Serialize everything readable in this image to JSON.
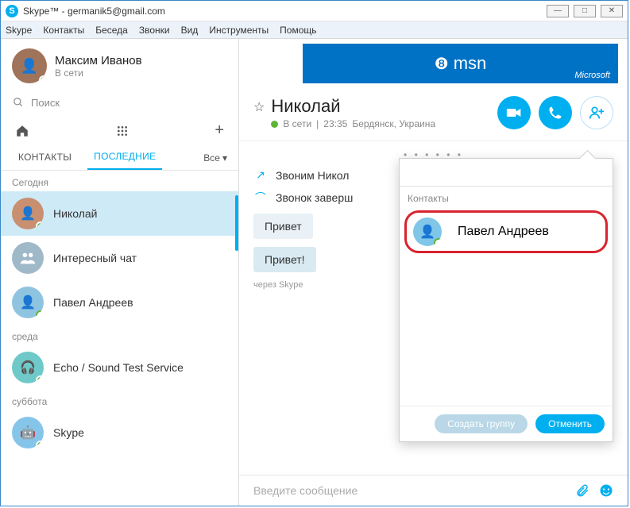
{
  "window": {
    "title": "Skype™ - germanik5@gmail.com"
  },
  "menu": [
    "Skype",
    "Контакты",
    "Беседа",
    "Звонки",
    "Вид",
    "Инструменты",
    "Помощь"
  ],
  "me": {
    "name": "Максим Иванов",
    "status": "В сети"
  },
  "search": {
    "placeholder": "Поиск"
  },
  "tabs": {
    "contacts": "КОНТАКТЫ",
    "recent": "ПОСЛЕДНИЕ",
    "filter": "Все"
  },
  "groups": [
    {
      "label": "Сегодня",
      "items": [
        {
          "name": "Николай",
          "selected": true,
          "avatarColor": "#c89070",
          "presence": "green"
        },
        {
          "name": "Интересный чат",
          "avatarColor": "#9fb9c9",
          "icon": "group"
        },
        {
          "name": "Павел Андреев",
          "avatarColor": "#8fc4e0",
          "presence": "ring"
        }
      ]
    },
    {
      "label": "среда",
      "items": [
        {
          "name": "Echo / Sound Test Service",
          "avatarColor": "#6fc9c9",
          "presence": "green",
          "icon": "headset"
        }
      ]
    },
    {
      "label": "суббота",
      "items": [
        {
          "name": "Skype",
          "avatarColor": "#86c5ea",
          "presence": "green",
          "icon": "bot"
        }
      ]
    }
  ],
  "banner": {
    "brand": "msn",
    "vendor": "Microsoft"
  },
  "chat": {
    "name": "Николай",
    "status": "В сети",
    "time": "23:35",
    "location": "Бердянск, Украина",
    "events": {
      "calling": "Звоним Никол",
      "ended": "Звонок заверш"
    },
    "messages": {
      "theirs": "Привет",
      "mine": "Привет!"
    },
    "via": "через Skype",
    "compose_placeholder": "Введите сообщение"
  },
  "popover": {
    "section": "Контакты",
    "contact": "Павел Андреев",
    "create": "Создать группу",
    "cancel": "Отменить"
  }
}
